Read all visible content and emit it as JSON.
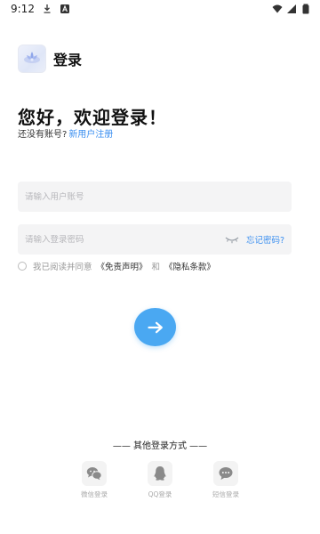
{
  "status_bar": {
    "time": "9:12"
  },
  "header": {
    "title": "登录"
  },
  "welcome": {
    "title": "您好，欢迎登录！",
    "no_account": "还没有账号?",
    "register_link": "新用户注册"
  },
  "form": {
    "account_placeholder": "请输入用户账号",
    "password_placeholder": "请输入登录密码",
    "forgot_password": "忘记密码?"
  },
  "agreement": {
    "prefix": "我已阅读并同意",
    "disclaimer": "《免责声明》",
    "and": "和",
    "privacy": "《隐私条款》"
  },
  "other_login": {
    "title": "—— 其他登录方式 ——",
    "methods": [
      {
        "label": "微信登录",
        "icon": "wechat-icon"
      },
      {
        "label": "QQ登录",
        "icon": "qq-icon"
      },
      {
        "label": "短信登录",
        "icon": "sms-icon"
      }
    ]
  },
  "colors": {
    "accent": "#3b8ff0",
    "button": "#4aa8f2",
    "field_bg": "#f4f4f5"
  }
}
